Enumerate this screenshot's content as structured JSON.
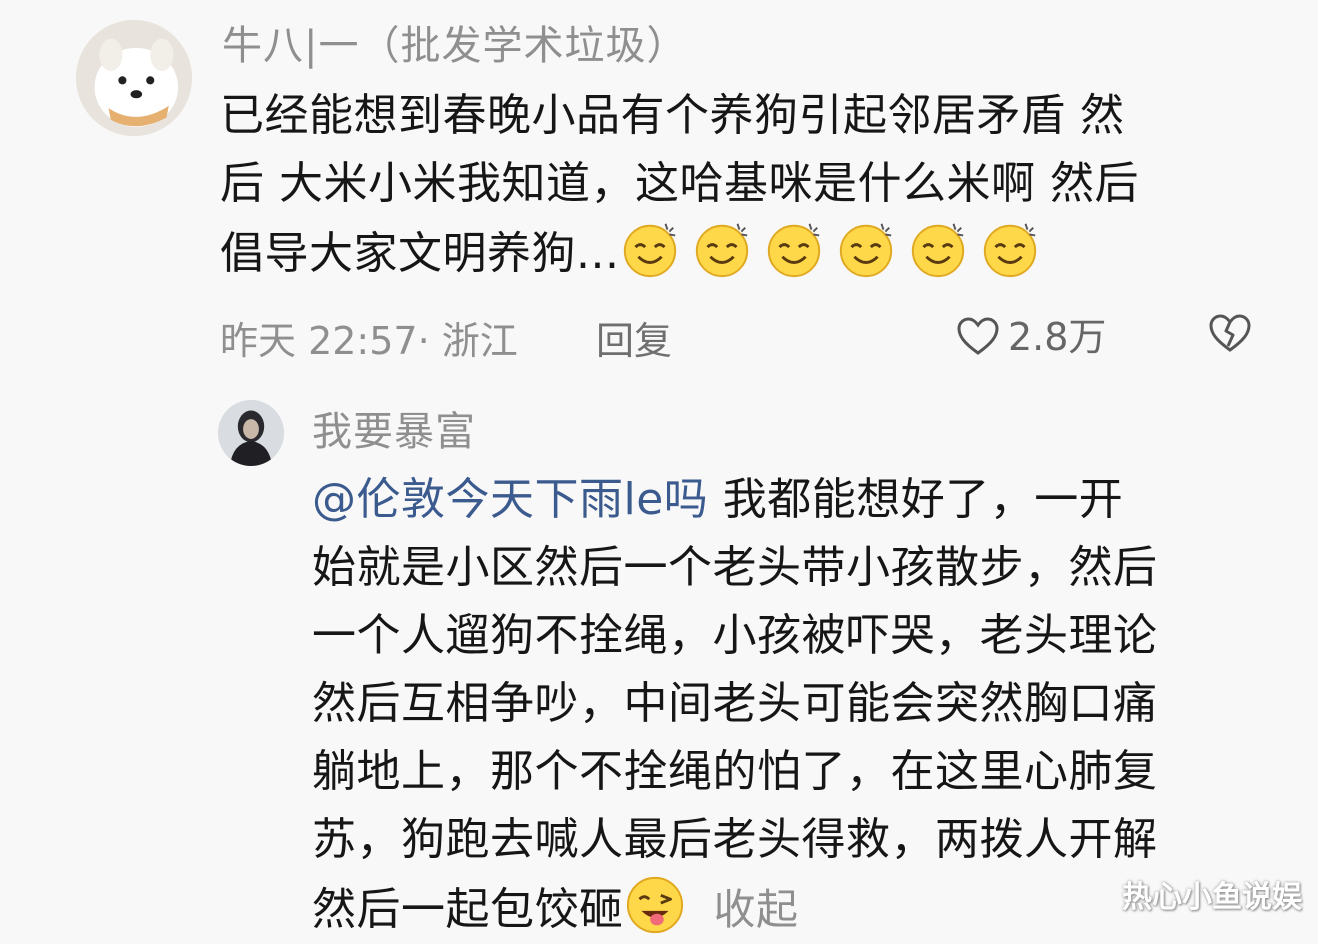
{
  "comment": {
    "username": "牛八|一（批发学术垃圾）",
    "text_lines": [
      "已经能想到春晚小品有个养狗引起邻居矛盾 然",
      "后 大米小米我知道，这哈基咪是什么米啊 然后",
      "倡导大家文明养狗..."
    ],
    "emoji_name": "proud-smile-emoji",
    "time_location": "昨天 22:57· 浙江",
    "reply_label": "回复",
    "like_count": "2.8万",
    "like_icon": "heart-outline-icon",
    "dislike_icon": "broken-heart-icon"
  },
  "reply": {
    "username": "我要暴富",
    "mention": "@伦敦今天下雨le吗",
    "first_line_rest": " 我都能想好了，一开",
    "text_lines": [
      "始就是小区然后一个老头带小孩散步，然后",
      "一个人遛狗不拴绳，小孩被吓哭，老头理论",
      "然后互相争吵，中间老头可能会突然胸口痛",
      "躺地上，那个不拴绳的怕了，在这里心肺复",
      "苏，狗跑去喊人最后老头得救，两拨人开解"
    ],
    "last_line": "然后一起包饺砸",
    "emoji_name": "wink-tongue-emoji",
    "collapse_label": "收起"
  },
  "watermark": "热心小鱼说娱",
  "colors": {
    "background": "#f8f8f8",
    "text": "#161616",
    "muted": "#8f8f8f",
    "mention": "#3b5a8e",
    "emoji_yellow": "#ffd84a"
  }
}
